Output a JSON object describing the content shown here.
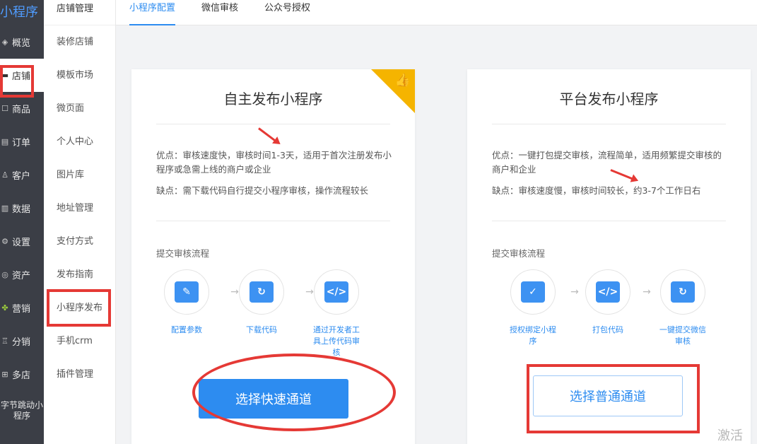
{
  "brand": "小程序",
  "nav": [
    {
      "label": "概览",
      "icon": "layers-icon"
    },
    {
      "label": "店铺",
      "icon": "store-icon",
      "active": true
    },
    {
      "label": "商品",
      "icon": "goods-icon"
    },
    {
      "label": "订单",
      "icon": "order-icon"
    },
    {
      "label": "客户",
      "icon": "customer-icon"
    },
    {
      "label": "数据",
      "icon": "chart-icon"
    },
    {
      "label": "设置",
      "icon": "gear-icon"
    },
    {
      "label": "资产",
      "icon": "asset-icon"
    },
    {
      "label": "营销",
      "icon": "marketing-icon"
    },
    {
      "label": "分销",
      "icon": "distribution-icon"
    },
    {
      "label": "多店",
      "icon": "multistore-icon"
    },
    {
      "label": "字节跳动小程序",
      "icon": ""
    }
  ],
  "subnav": {
    "header": "店铺管理",
    "items": [
      "装修店铺",
      "模板市场",
      "微页面",
      "个人中心",
      "图片库",
      "地址管理",
      "支付方式",
      "发布指南",
      "小程序发布",
      "手机crm",
      "插件管理"
    ]
  },
  "tabs": [
    "小程序配置",
    "微信审核",
    "公众号授权"
  ],
  "cards": [
    {
      "title": "自主发布小程序",
      "pros": "优点：审核速度快，审核时间1-3天，适用于首次注册发布小程序或急需上线的商户或企业",
      "cons": "缺点：需下载代码自行提交小程序审核，操作流程较长",
      "flow_label": "提交审核流程",
      "steps": [
        {
          "label": "配置参数",
          "icon": "pencil-icon",
          "glyph": "✎"
        },
        {
          "label": "下载代码",
          "icon": "download-code-icon",
          "glyph": "↻"
        },
        {
          "label": "通过开发者工具上传代码审核",
          "icon": "upload-code-icon",
          "glyph": "</>"
        }
      ],
      "button": "选择快速通道",
      "badge_icon": "thumbs-up-icon"
    },
    {
      "title": "平台发布小程序",
      "pros": "优点：一键打包提交审核，流程简单，适用频繁提交审核的商户和企业",
      "cons": "缺点：审核速度慢，审核时间较长，约3-7个工作日右",
      "flow_label": "提交审核流程",
      "steps": [
        {
          "label": "授权绑定小程序",
          "icon": "authorize-icon",
          "glyph": "✓"
        },
        {
          "label": "打包代码",
          "icon": "package-code-icon",
          "glyph": "</>"
        },
        {
          "label": "一键提交微信审核",
          "icon": "submit-review-icon",
          "glyph": "↻"
        }
      ],
      "button": "选择普通通道"
    }
  ],
  "watermark": "激活 W",
  "colors": {
    "accent": "#2d8cf0",
    "nav_bg": "#3b3e46",
    "badge": "#f5b400",
    "annotation": "#e53935"
  }
}
